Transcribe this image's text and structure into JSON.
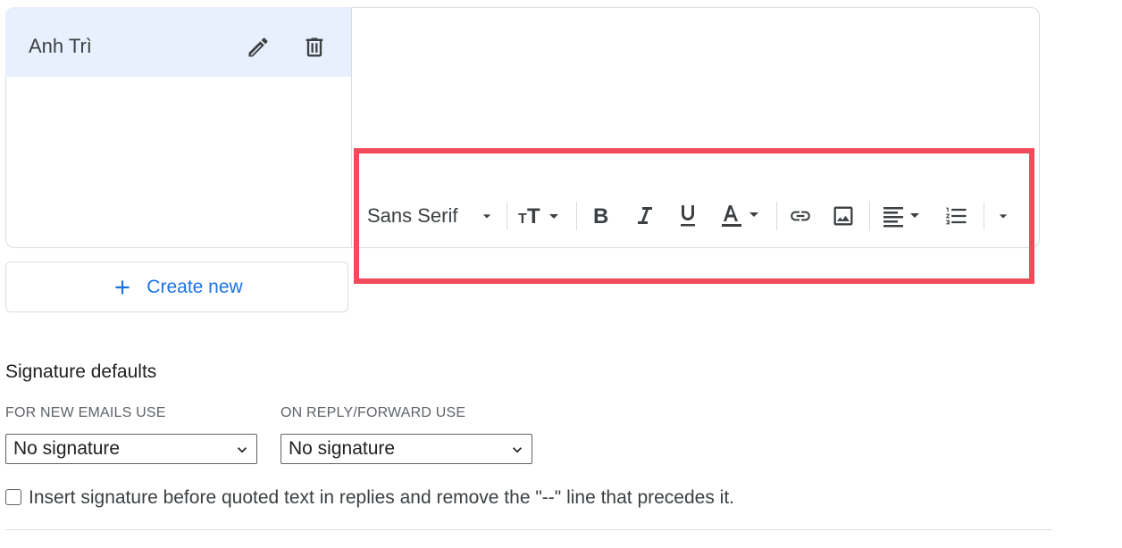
{
  "signatures": {
    "items": [
      {
        "name": "Anh Trì"
      }
    ],
    "create_new_label": "Create new"
  },
  "toolbar": {
    "font_family": "Sans Serif",
    "buttons": [
      "font-size",
      "bold",
      "italic",
      "underline",
      "text-color",
      "link",
      "image",
      "align",
      "numbered-list",
      "more-formatting"
    ]
  },
  "defaults": {
    "title": "Signature defaults",
    "new_emails_label": "FOR NEW EMAILS USE",
    "new_emails_value": "No signature",
    "reply_forward_label": "ON REPLY/FORWARD USE",
    "reply_forward_value": "No signature",
    "insert_before_quoted_label": "Insert signature before quoted text in replies and remove the \"--\" line that precedes it.",
    "insert_before_quoted_checked": false
  },
  "colors": {
    "selected_row": "#e8f0fe",
    "accent": "#1a73e8",
    "highlight": "#f2495b"
  }
}
